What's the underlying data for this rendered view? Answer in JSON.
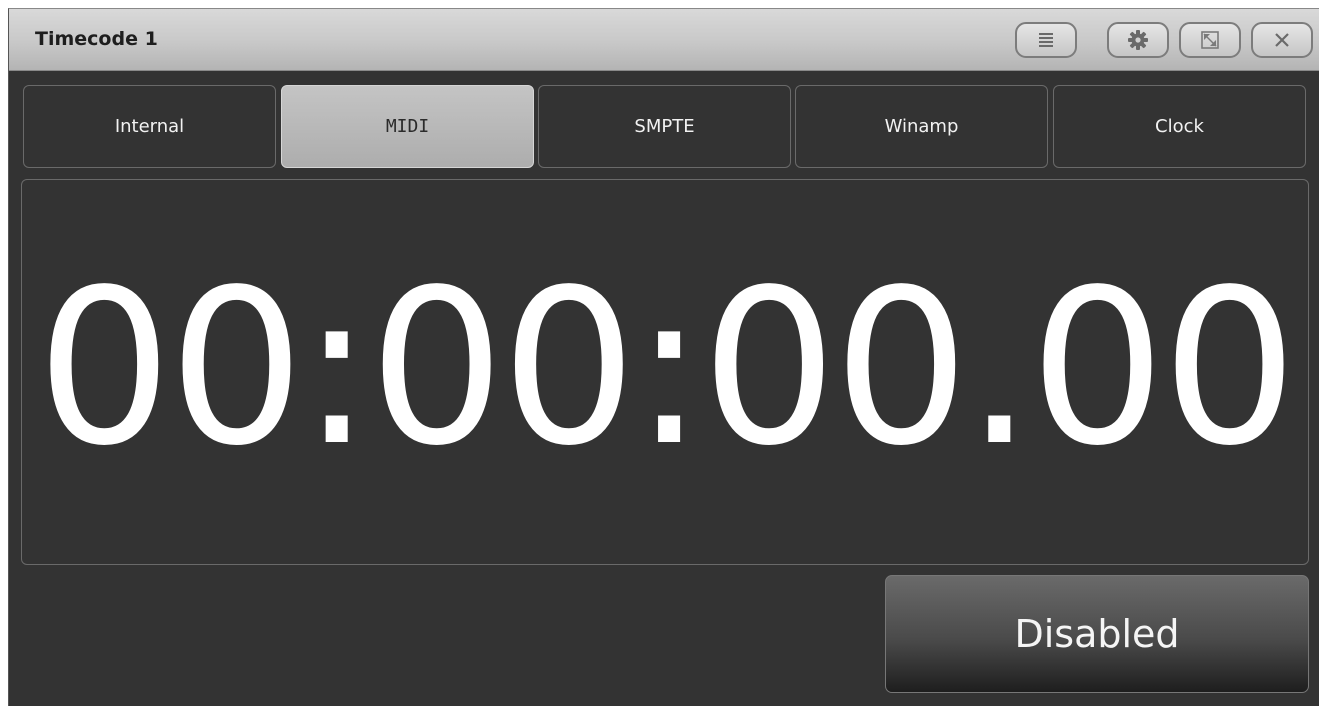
{
  "window": {
    "title": "Timecode 1"
  },
  "titlebar_buttons": [
    {
      "name": "menu",
      "icon": "menu-icon"
    },
    {
      "name": "settings",
      "icon": "gear-icon"
    },
    {
      "name": "maximize",
      "icon": "maximize-icon"
    },
    {
      "name": "close",
      "icon": "close-icon"
    }
  ],
  "tabs": [
    {
      "label": "Internal",
      "selected": false
    },
    {
      "label": "MIDI",
      "selected": true
    },
    {
      "label": "SMPTE",
      "selected": false
    },
    {
      "label": "Winamp",
      "selected": false
    },
    {
      "label": "Clock",
      "selected": false
    }
  ],
  "display": {
    "timecode": "00:00:00.00"
  },
  "status_button": {
    "label": "Disabled"
  },
  "colors": {
    "background": "#333333",
    "titlebar": "#c8c8c8",
    "active_tab": "#b4b4b4",
    "text": "#ffffff"
  }
}
